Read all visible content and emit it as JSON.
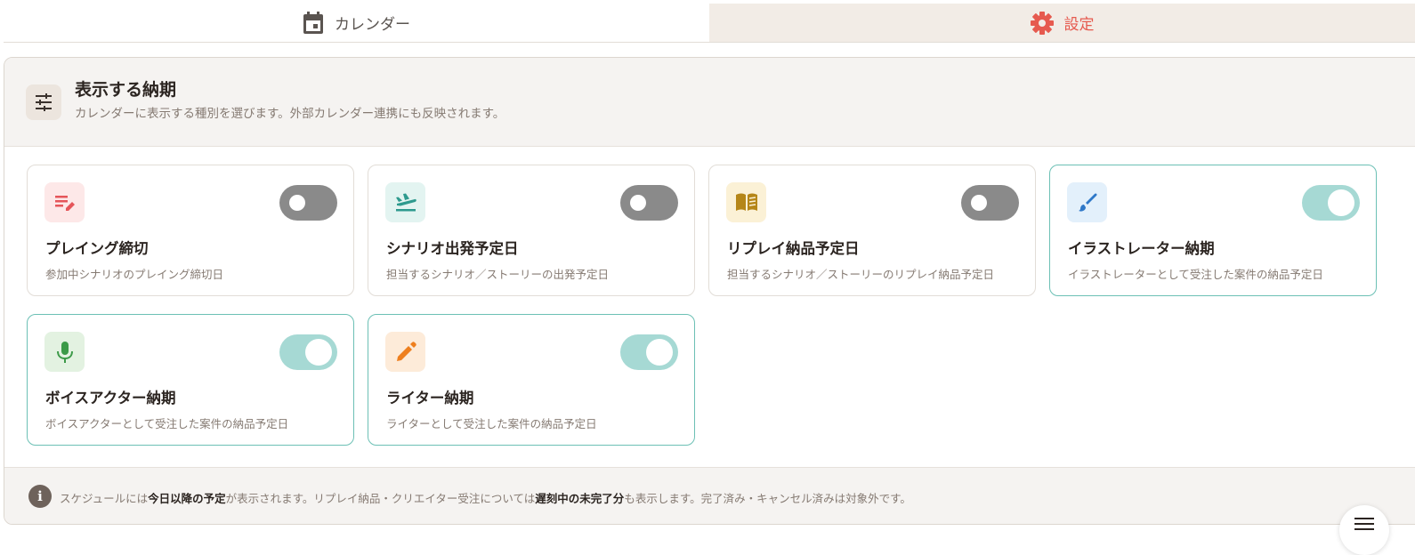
{
  "tabs": [
    {
      "label": "カレンダー",
      "icon": "calendar-icon",
      "active": false
    },
    {
      "label": "設定",
      "icon": "gear-icon",
      "active": true
    }
  ],
  "section": {
    "title": "表示する納期",
    "description": "カレンダーに表示する種別を選びます。外部カレンダー連携にも反映されます。",
    "icon": "sliders-icon"
  },
  "cards": [
    {
      "title": "プレイング締切",
      "description": "参加中シナリオのプレイング締切日",
      "icon": "playing-edit-icon",
      "enabled": false,
      "icon_bg": "#fde8e8",
      "icon_color": "#e5555a"
    },
    {
      "title": "シナリオ出発予定日",
      "description": "担当するシナリオ／ストーリーの出発予定日",
      "icon": "flight-takeoff-icon",
      "enabled": false,
      "icon_bg": "#e3f4f1",
      "icon_color": "#2e9a8e"
    },
    {
      "title": "リプレイ納品予定日",
      "description": "担当するシナリオ／ストーリーのリプレイ納品予定日",
      "icon": "book-icon",
      "enabled": false,
      "icon_bg": "#fbf1d6",
      "icon_color": "#b58618"
    },
    {
      "title": "イラストレーター納期",
      "description": "イラストレーターとして受注した案件の納品予定日",
      "icon": "brush-icon",
      "enabled": true,
      "icon_bg": "#e3f0fb",
      "icon_color": "#2f78c8"
    },
    {
      "title": "ボイスアクター納期",
      "description": "ボイスアクターとして受注した案件の納品予定日",
      "icon": "mic-icon",
      "enabled": true,
      "icon_bg": "#e3f2e1",
      "icon_color": "#3c9a48"
    },
    {
      "title": "ライター納期",
      "description": "ライターとして受注した案件の納品予定日",
      "icon": "pencil-icon",
      "enabled": true,
      "icon_bg": "#fdebd9",
      "icon_color": "#ee7f1e"
    }
  ],
  "footer": {
    "icon": "info-icon",
    "text_1": "スケジュールには",
    "bold_1": "今日以降の予定",
    "text_2": "が表示されます。リプレイ納品・クリエイター受注については",
    "bold_2": "遅刻中の未完了分",
    "text_3": "も表示します。完了済み・キャンセル済みは対象外です。"
  },
  "fab": {
    "icon": "menu-icon"
  },
  "colors": {
    "accent": "#e65a4f",
    "toggle_on": "#a6d9d4",
    "toggle_off": "#8a8a8a",
    "card_on_border": "#6cc0b5"
  }
}
